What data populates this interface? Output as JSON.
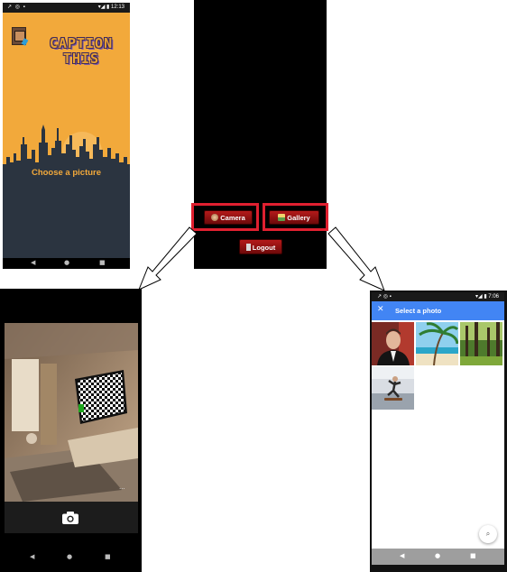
{
  "main_app": {
    "status_left": "↗ ◎ ▪",
    "status_right": "▾◢ ▮ 12:13",
    "title_line1": "CAPTION",
    "title_line2": "THIS",
    "prompt": "Choose a picture",
    "camera_label": "Camera",
    "gallery_label": "Gallery",
    "logout_label": "Logout",
    "colors": {
      "background": "#F2A93B",
      "bottom_panel": "#2B3440",
      "button_red": "#9A1212",
      "highlight": "#E02030"
    }
  },
  "camera_screen": {
    "shutter_icon": "camera-icon",
    "more_icon": "..."
  },
  "photo_picker": {
    "status_left": "↗ ◎ ▪",
    "status_right": "▾◢ ▮ 7:06",
    "title": "Select a photo",
    "close_icon": "✕",
    "zoom_icon": "⌕",
    "header_color": "#4285F4"
  },
  "nav_glyphs": {
    "back": "◀",
    "home": "●",
    "recents": "■"
  }
}
